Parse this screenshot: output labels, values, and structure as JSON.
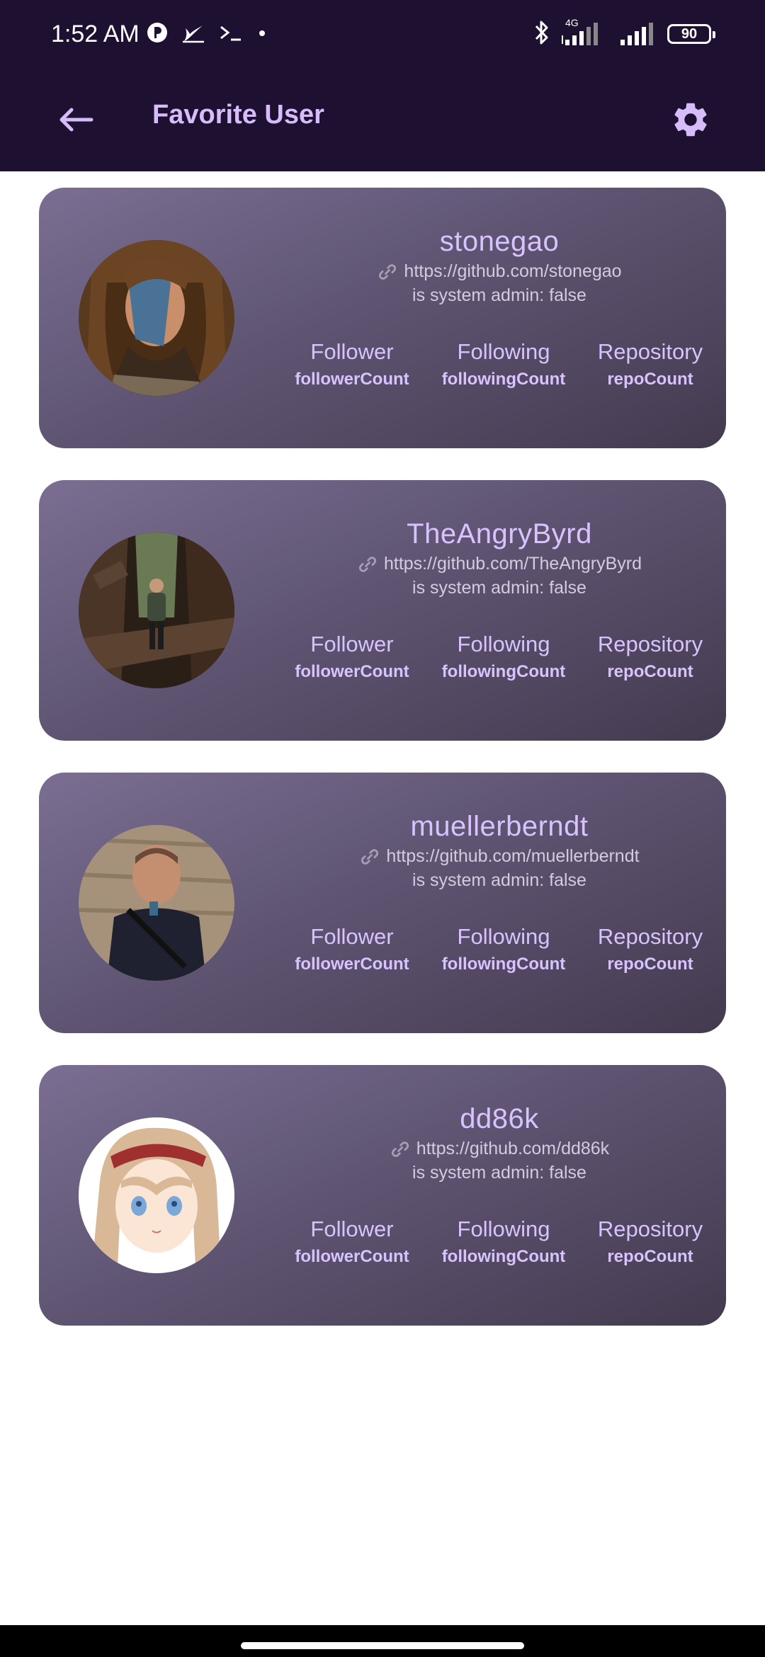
{
  "status_bar": {
    "time": "1:52 AM",
    "network_label": "4G",
    "battery": "90",
    "left_icons": [
      "notification-icon",
      "feather-icon",
      "terminal-icon",
      "dot-icon"
    ],
    "right_icons": [
      "bluetooth-icon",
      "signal-icon",
      "signal-icon",
      "battery-icon"
    ]
  },
  "app_bar": {
    "title": "Favorite User",
    "back_icon": "arrow-back-icon",
    "settings_icon": "gear-icon",
    "accent_color": "#d6bdfa",
    "background_color": "#1e1030"
  },
  "users": [
    {
      "username": "stonegao",
      "url": "https://github.com/stonegao",
      "admin": "is system admin: false",
      "stats": [
        {
          "label": "Follower",
          "value": "followerCount"
        },
        {
          "label": "Following",
          "value": "followingCount"
        },
        {
          "label": "Repository",
          "value": "repoCount"
        }
      ]
    },
    {
      "username": "TheAngryByrd",
      "url": "https://github.com/TheAngryByrd",
      "admin": "is system admin: false",
      "stats": [
        {
          "label": "Follower",
          "value": "followerCount"
        },
        {
          "label": "Following",
          "value": "followingCount"
        },
        {
          "label": "Repository",
          "value": "repoCount"
        }
      ]
    },
    {
      "username": "muellerberndt",
      "url": "https://github.com/muellerberndt",
      "admin": "is system admin: false",
      "stats": [
        {
          "label": "Follower",
          "value": "followerCount"
        },
        {
          "label": "Following",
          "value": "followingCount"
        },
        {
          "label": "Repository",
          "value": "repoCount"
        }
      ]
    },
    {
      "username": "dd86k",
      "url": "https://github.com/dd86k",
      "admin": "is system admin: false",
      "stats": [
        {
          "label": "Follower",
          "value": "followerCount"
        },
        {
          "label": "Following",
          "value": "followingCount"
        },
        {
          "label": "Repository",
          "value": "repoCount"
        }
      ]
    }
  ]
}
